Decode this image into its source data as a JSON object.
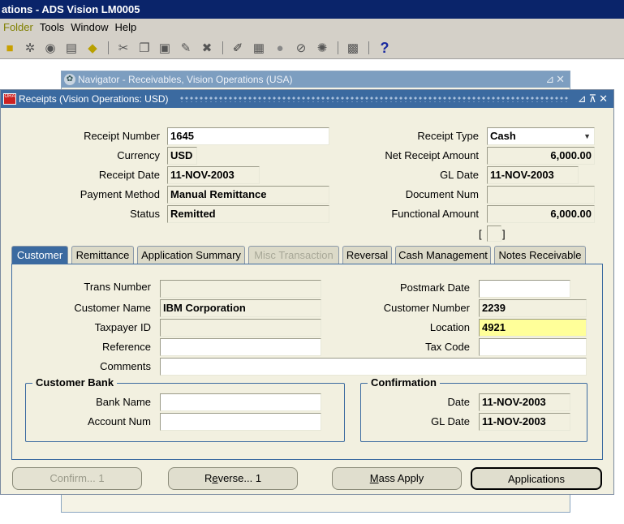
{
  "app": {
    "title": "ations - ADS Vision LM0005"
  },
  "menu": {
    "folder": "Folder",
    "tools": "Tools",
    "window": "Window",
    "help": "Help"
  },
  "navigator": {
    "title": "Navigator - Receivables, Vision Operations (USA)"
  },
  "receipts": {
    "title": "Receipts (Vision Operations: USD)",
    "header": {
      "receipt_number": {
        "label": "Receipt Number",
        "value": "1645"
      },
      "currency": {
        "label": "Currency",
        "value": "USD"
      },
      "receipt_date": {
        "label": "Receipt Date",
        "value": "11-NOV-2003"
      },
      "payment_method": {
        "label": "Payment Method",
        "value": "Manual Remittance"
      },
      "status": {
        "label": "Status",
        "value": "Remitted"
      },
      "receipt_type": {
        "label": "Receipt Type",
        "value": "Cash"
      },
      "net_receipt_amount": {
        "label": "Net Receipt Amount",
        "value": "6,000.00"
      },
      "gl_date": {
        "label": "GL Date",
        "value": "11-NOV-2003"
      },
      "document_num": {
        "label": "Document Num",
        "value": ""
      },
      "functional_amount": {
        "label": "Functional Amount",
        "value": "6,000.00"
      },
      "dff_open": "[",
      "dff_close": "]"
    },
    "tabs": [
      "Customer",
      "Remittance",
      "Application Summary",
      "Misc Transaction",
      "Reversal",
      "Cash Management",
      "Notes Receivable"
    ],
    "customer": {
      "trans_number": {
        "label": "Trans Number",
        "value": ""
      },
      "customer_name": {
        "label": "Customer Name",
        "value": "IBM Corporation"
      },
      "taxpayer_id": {
        "label": "Taxpayer ID",
        "value": ""
      },
      "reference": {
        "label": "Reference",
        "value": ""
      },
      "comments": {
        "label": "Comments",
        "value": ""
      },
      "postmark_date": {
        "label": "Postmark Date",
        "value": ""
      },
      "customer_number": {
        "label": "Customer Number",
        "value": "2239"
      },
      "location": {
        "label": "Location",
        "value": "4921"
      },
      "tax_code": {
        "label": "Tax Code",
        "value": ""
      },
      "customer_bank": {
        "title": "Customer Bank",
        "bank_name": {
          "label": "Bank Name",
          "value": ""
        },
        "account_num": {
          "label": "Account Num",
          "value": ""
        }
      },
      "confirmation": {
        "title": "Confirmation",
        "date": {
          "label": "Date",
          "value": "11-NOV-2003"
        },
        "gl_date": {
          "label": "GL Date",
          "value": "11-NOV-2003"
        }
      }
    },
    "buttons": {
      "confirm": "Confirm... 1",
      "reverse_pre": "R",
      "reverse_ul": "e",
      "reverse_post": "verse... 1",
      "mass_apply_ul": "M",
      "mass_apply_post": "ass Apply",
      "applications": "Applications"
    }
  },
  "colors": {
    "title_blue": "#3b6aa0",
    "active_field": "#ffff99",
    "window_bg": "#f2f0e0"
  },
  "icons": [
    "new-icon",
    "find-icon",
    "navigator-icon",
    "print-icon",
    "attachments-icon",
    "cut-icon",
    "copy-icon",
    "paste-icon",
    "clear-record-icon",
    "delete-icon",
    "edit-icon",
    "zoom-icon",
    "translations-icon",
    "attach-icon",
    "folder-tools-icon",
    "help-icon"
  ]
}
